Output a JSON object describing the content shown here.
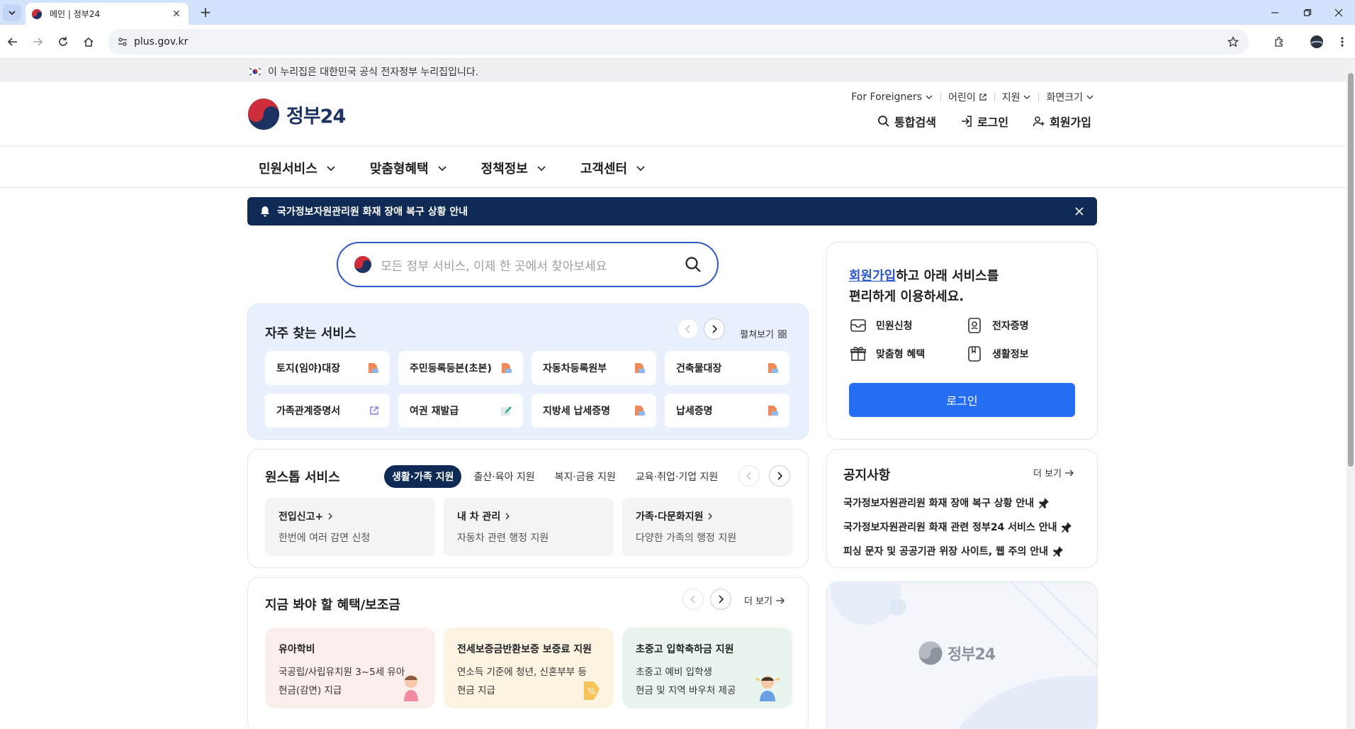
{
  "browser": {
    "tab_title": "메인 | 정부24",
    "url": "plus.gov.kr"
  },
  "gov_banner": "이 누리집은 대한민국 공식 전자정부 누리집입니다.",
  "header": {
    "logo_text": "정부24",
    "util": {
      "foreigners": "For Foreigners",
      "kids": "어린이",
      "support": "지원",
      "screen_size": "화면크기"
    },
    "user": {
      "search": "통합검색",
      "login": "로그인",
      "signup": "회원가입"
    }
  },
  "gnb": [
    "민원서비스",
    "맞춤형혜택",
    "정책정보",
    "고객센터"
  ],
  "alert": {
    "text": "국가정보자원관리원 화재 장애 복구 상황 안내"
  },
  "search": {
    "placeholder": "모든 정부 서비스, 이제 한 곳에서 찾아보세요"
  },
  "frequent": {
    "title": "자주 찾는 서비스",
    "expand": "펼쳐보기",
    "items": [
      {
        "label": "토지(임야)대장",
        "icon": "document-icon"
      },
      {
        "label": "주민등록등본(초본)",
        "icon": "document-icon"
      },
      {
        "label": "자동차등록원부",
        "icon": "document-icon"
      },
      {
        "label": "건축물대장",
        "icon": "document-icon"
      },
      {
        "label": "가족관계증명서",
        "icon": "external-link-icon"
      },
      {
        "label": "여권 재발급",
        "icon": "pen-icon"
      },
      {
        "label": "지방세 납세증명",
        "icon": "document-icon"
      },
      {
        "label": "납세증명",
        "icon": "document-icon"
      }
    ]
  },
  "onestop": {
    "title": "원스톱 서비스",
    "tabs": [
      "생활·가족 지원",
      "출산·육아 지원",
      "복지·금융 지원",
      "교육·취업·기업 지원"
    ],
    "items": [
      {
        "title": "전입신고+",
        "desc": "한번에 여러 감면 신청"
      },
      {
        "title": "내 차 관리",
        "desc": "자동차 관련 행정 지원"
      },
      {
        "title": "가족·다문화지원",
        "desc": "다양한 가족의 행정 지원"
      }
    ]
  },
  "benefits": {
    "title": "지금 봐야 할 혜택/보조금",
    "more": "더 보기",
    "items": [
      {
        "title": "유아학비",
        "line1": "국공립/사립유치원 3~5세 유아",
        "line2": "현금(감면) 지급",
        "bg": "#fdeeee"
      },
      {
        "title": "전세보증금반환보증 보증료 지원",
        "line1": "연소득 기준에 청년, 신혼부부 등",
        "line2": "현금 지급",
        "bg": "#fdf3e1"
      },
      {
        "title": "초중고 입학축하금 지원",
        "line1": "초중고 예비 입학생",
        "line2": "현금 및 지역 바우처 제공",
        "bg": "#e9f5ec"
      }
    ]
  },
  "loginbox": {
    "link": "회원가입",
    "msg1": "하고 아래 서비스를",
    "msg2": "편리하게 이용하세요.",
    "services": [
      "민원신청",
      "전자증명",
      "맞춤형 혜택",
      "생활정보"
    ],
    "button": "로그인"
  },
  "notice": {
    "title": "공지사항",
    "more": "더 보기",
    "items": [
      "국가정보자원관리원 화재 장애 복구 상황 안내",
      "국가정보자원관리원 화재 관련 정부24 서비스 안내",
      "피싱 문자 및 공공기관 위장 사이트, 웹 주의 안내"
    ]
  },
  "banner": {
    "logo_text": "정부24"
  },
  "colors": {
    "navy": "#0f2a55",
    "primary_blue": "#256ef4",
    "link_blue": "#2b57c9",
    "freq_bg": "#e8f1fd"
  }
}
